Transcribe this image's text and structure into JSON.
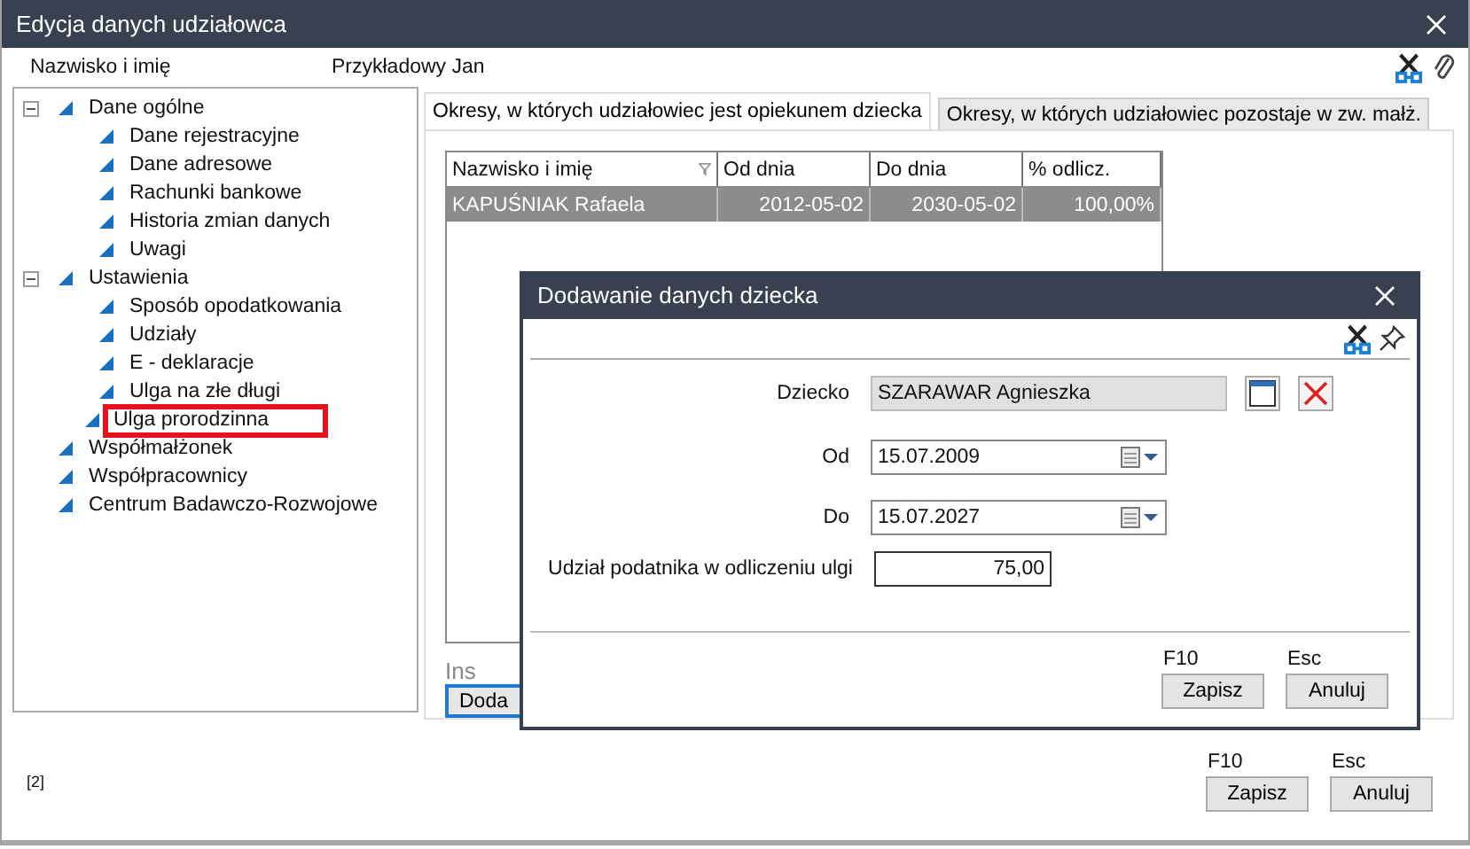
{
  "window": {
    "title": "Edycja danych udziałowca"
  },
  "header": {
    "label": "Nazwisko i imię",
    "value": "Przykładowy Jan"
  },
  "tree": [
    {
      "label": "Dane ogólne",
      "expanded": true,
      "highlighted": false,
      "children": [
        {
          "label": "Dane rejestracyjne",
          "highlighted": false
        },
        {
          "label": "Dane adresowe",
          "highlighted": false
        },
        {
          "label": "Rachunki bankowe",
          "highlighted": false
        },
        {
          "label": "Historia zmian danych",
          "highlighted": false
        },
        {
          "label": "Uwagi",
          "highlighted": false
        }
      ]
    },
    {
      "label": "Ustawienia",
      "expanded": true,
      "highlighted": false,
      "children": [
        {
          "label": "Sposób opodatkowania",
          "highlighted": false
        },
        {
          "label": "Udziały",
          "highlighted": false
        },
        {
          "label": "E - deklaracje",
          "highlighted": false
        },
        {
          "label": "Ulga na złe długi",
          "highlighted": false
        },
        {
          "label": "Ulga prorodzinna",
          "highlighted": true
        }
      ]
    },
    {
      "label": "Współmałżonek",
      "highlighted": false
    },
    {
      "label": "Współpracownicy",
      "highlighted": false
    },
    {
      "label": "Centrum Badawczo-Rozwojowe",
      "highlighted": false
    }
  ],
  "tabs": [
    {
      "label": "Okresy, w których udziałowiec jest opiekunem dziecka",
      "selected": true
    },
    {
      "label": "Okresy, w których udziałowiec pozostaje w zw. małż.",
      "selected": false
    }
  ],
  "table": {
    "columns": [
      "Nazwisko i imię",
      "Od dnia",
      "Do dnia",
      "% odlicz."
    ],
    "rows": [
      {
        "cells": [
          "KAPUŚNIAK Rafaela",
          "2012-05-02",
          "2030-05-02",
          "100,00%"
        ],
        "selected": true
      }
    ]
  },
  "add_shortcut": "Ins",
  "add_button": "Doda",
  "dialog": {
    "title": "Dodawanie danych dziecka",
    "fields": [
      {
        "kind": "lookup",
        "label": "Dziecko",
        "value": "SZARAWAR Agnieszka"
      },
      {
        "kind": "date",
        "label": "Od",
        "value": "15.07.2009"
      },
      {
        "kind": "date",
        "label": "Do",
        "value": "15.07.2027"
      },
      {
        "kind": "number",
        "label": "Udział podatnika w odliczeniu ulgi",
        "value": "75,00"
      }
    ],
    "buttons": [
      {
        "shortcut": "F10",
        "label": "Zapisz"
      },
      {
        "shortcut": "Esc",
        "label": "Anuluj"
      }
    ]
  },
  "footer": {
    "page": "[2]",
    "buttons": [
      {
        "shortcut": "F10",
        "label": "Zapisz"
      },
      {
        "shortcut": "Esc",
        "label": "Anuluj"
      }
    ]
  }
}
